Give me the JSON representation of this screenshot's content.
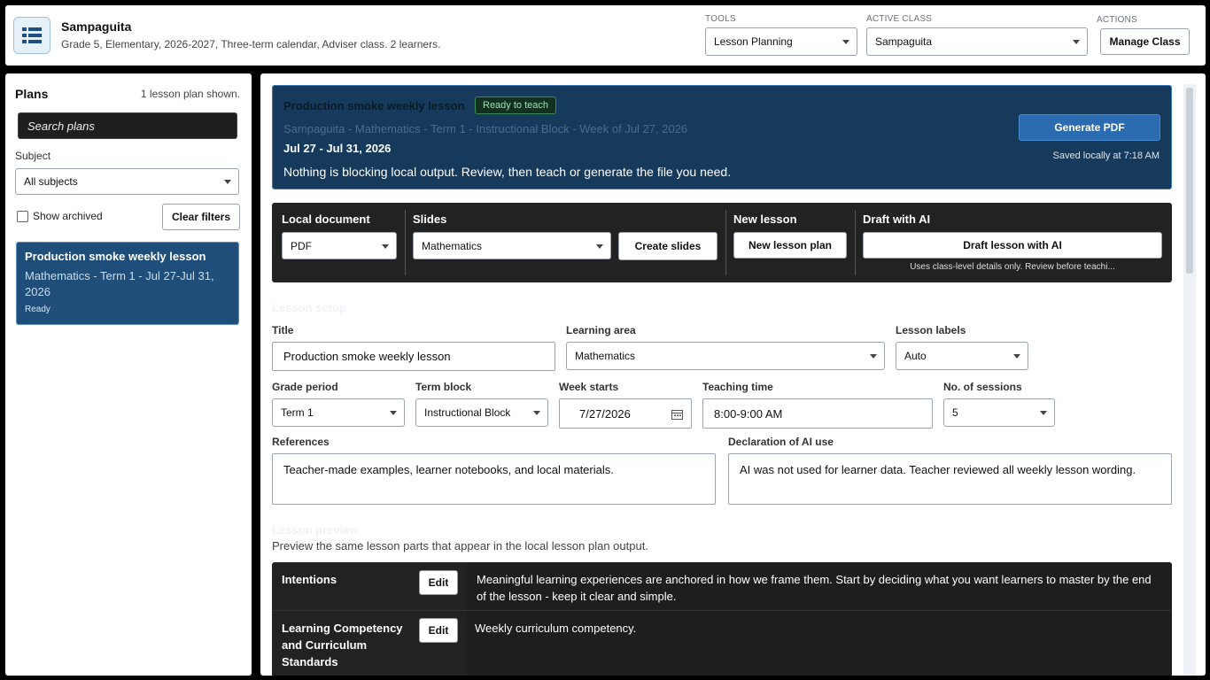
{
  "header": {
    "title": "Sampaguita",
    "subtitle": "Grade 5, Elementary, 2026-2027, Three-term calendar, Adviser class. 2 learners.",
    "tools_label": "TOOLS",
    "tools_value": "Lesson Planning",
    "active_class_label": "ACTIVE CLASS",
    "active_class_value": "Sampaguita",
    "actions_label": "ACTIONS",
    "manage_class": "Manage Class",
    "icon": "list-icon"
  },
  "sidebar": {
    "title": "Plans",
    "count": "1 lesson plan shown.",
    "search_placeholder": "Search plans",
    "subject_label": "Subject",
    "subject_value": "All subjects",
    "show_archived": "Show archived",
    "clear_filters": "Clear filters",
    "plans": [
      {
        "title": "Production smoke weekly lesson",
        "subtitle": "Mathematics - Term 1 - Jul 27-Jul 31, 2026",
        "status": "Ready"
      }
    ]
  },
  "banner": {
    "title": "Production smoke weekly lesson",
    "badge": "Ready to teach",
    "path": "Sampaguita - Mathematics - Term 1 - Instructional Block - Week of Jul 27, 2026",
    "dates": "Jul 27 - Jul 31, 2026",
    "message": "Nothing is blocking local output. Review, then teach or generate the file you need.",
    "generate": "Generate PDF",
    "saved": "Saved locally at 7:18 AM"
  },
  "toolbar": {
    "local_doc_title": "Local document",
    "local_doc_value": "PDF",
    "slides_title": "Slides",
    "slides_value": "Mathematics",
    "create_slides": "Create slides",
    "new_lesson_title": "New lesson",
    "new_lesson_plan": "New lesson plan",
    "draft_title": "Draft with AI",
    "draft_button": "Draft lesson with AI",
    "draft_note": "Uses class-level details only. Review before teachi..."
  },
  "setup": {
    "heading": "Lesson setup",
    "title_label": "Title",
    "title_value": "Production smoke weekly lesson",
    "area_label": "Learning area",
    "area_value": "Mathematics",
    "labels_label": "Lesson labels",
    "labels_value": "Auto",
    "grade_label": "Grade period",
    "grade_value": "Term 1",
    "term_label": "Term block",
    "term_value": "Instructional Block",
    "week_label": "Week starts",
    "week_value": "7/27/2026",
    "time_label": "Teaching time",
    "time_value": "8:00-9:00 AM",
    "sessions_label": "No. of sessions",
    "sessions_value": "5",
    "refs_label": "References",
    "refs_value": "Teacher-made examples, learner notebooks, and local materials.",
    "ai_label": "Declaration of AI use",
    "ai_value": "AI was not used for learner data. Teacher reviewed all weekly lesson wording."
  },
  "preview": {
    "heading": "Lesson preview",
    "subtitle": "Preview the same lesson parts that appear in the local lesson plan output.",
    "edit_label": "Edit",
    "rows": [
      {
        "label": "Intentions",
        "content": "Meaningful learning experiences are anchored in how we frame them. Start by deciding what you want learners to master by the end of the lesson - keep it clear and simple."
      },
      {
        "label": "Learning Competency and Curriculum Standards",
        "content": "Weekly curriculum competency."
      }
    ]
  },
  "colors": {
    "accent": "#2b6cb0",
    "banner_bg": "#163a5c",
    "ready_green": "#9be0b0"
  }
}
